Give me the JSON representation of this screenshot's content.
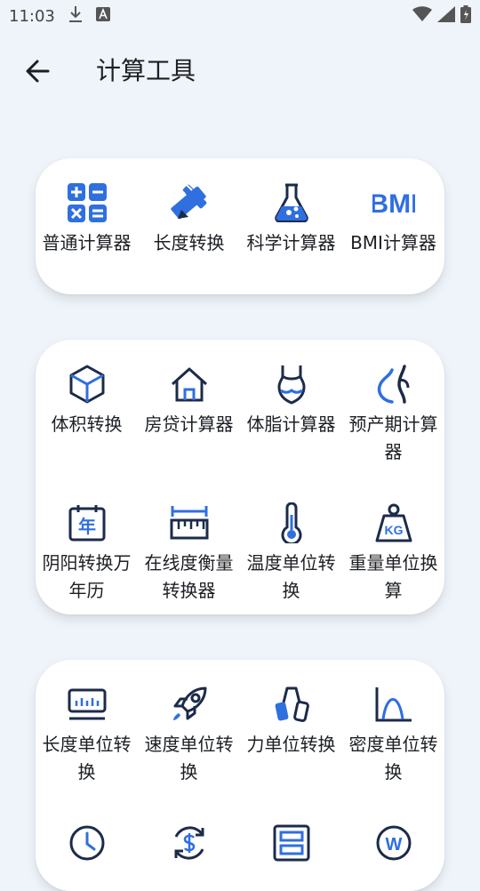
{
  "status": {
    "time": "11:03"
  },
  "header": {
    "title": "计算工具"
  },
  "colors": {
    "accent": "#2f6fe0",
    "dark": "#1c2b4a",
    "background": "#eef4fa",
    "card": "#ffffff"
  },
  "sections": [
    {
      "items": [
        {
          "label": "普通计算器",
          "icon": "calculator-icon"
        },
        {
          "label": "长度转换",
          "icon": "ruler-pencil-icon"
        },
        {
          "label": "科学计算器",
          "icon": "flask-icon"
        },
        {
          "label": "BMI计算器",
          "icon": "bmi-icon",
          "icon_text": "BMI"
        }
      ]
    },
    {
      "items": [
        {
          "label": "体积转换",
          "icon": "cube-icon"
        },
        {
          "label": "房贷计算器",
          "icon": "house-icon"
        },
        {
          "label": "体脂计算器",
          "icon": "swimsuit-icon"
        },
        {
          "label": "预产期计算器",
          "icon": "pregnancy-icon"
        },
        {
          "label": "阴阳转换万年历",
          "icon": "calendar-icon",
          "icon_text": "年"
        },
        {
          "label": "在线度衡量转换器",
          "icon": "measure-icon"
        },
        {
          "label": "温度单位转换",
          "icon": "thermometer-icon"
        },
        {
          "label": "重量单位换算",
          "icon": "weight-icon",
          "icon_text": "KG"
        }
      ]
    },
    {
      "items": [
        {
          "label": "长度单位转换",
          "icon": "length-gauge-icon"
        },
        {
          "label": "速度单位转换",
          "icon": "rocket-icon"
        },
        {
          "label": "力单位转换",
          "icon": "hand-grip-icon"
        },
        {
          "label": "密度单位转换",
          "icon": "density-curve-icon"
        },
        {
          "label": "",
          "icon": "clock-icon"
        },
        {
          "label": "",
          "icon": "currency-exchange-icon"
        },
        {
          "label": "",
          "icon": "data-storage-icon"
        },
        {
          "label": "",
          "icon": "power-w-icon",
          "icon_text": "W"
        }
      ]
    }
  ]
}
